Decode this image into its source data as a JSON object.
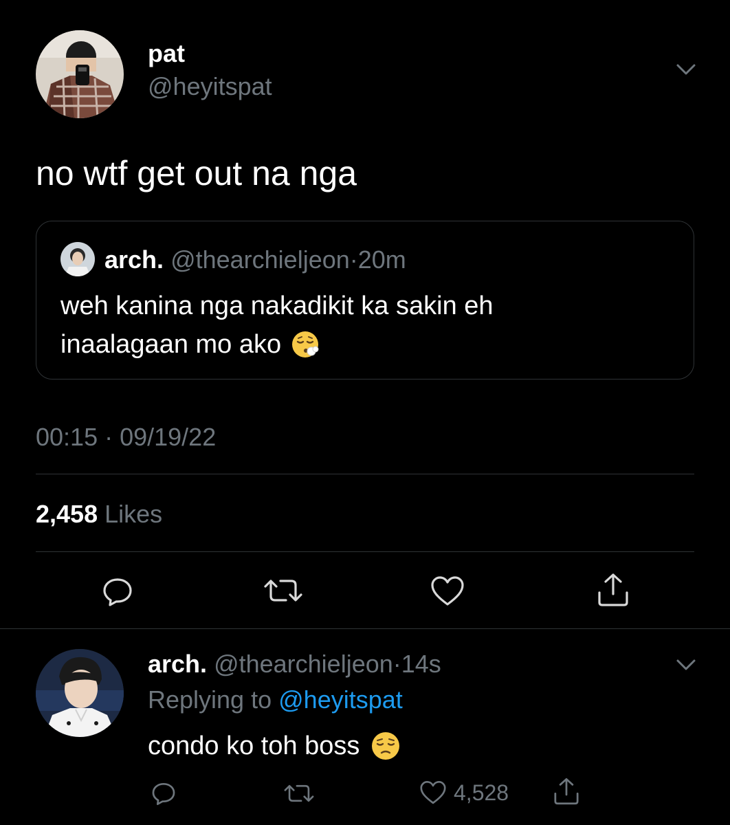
{
  "main_tweet": {
    "author_name": "pat",
    "author_handle": "@heyitspat",
    "text": "no wtf get out na nga",
    "quoted": {
      "author_name": "arch.",
      "author_handle": "@thearchieljeon",
      "separator": "·",
      "time": "20m",
      "line1": "weh kanina nga nakadikit ka sakin eh",
      "line2": "inaalagaan mo ako",
      "emoji": "face-exhaling-emoji"
    },
    "timestamp": "00:15 · 09/19/22",
    "likes_count": "2,458",
    "likes_label": "Likes",
    "actions": [
      "reply-icon",
      "retweet-icon",
      "like-icon",
      "share-icon"
    ]
  },
  "reply_tweet": {
    "author_name": "arch.",
    "author_handle": "@thearchieljeon",
    "separator": "·",
    "time": "14s",
    "replying_prefix": "Replying to",
    "replying_handle": "@heyitspat",
    "text": "condo ko toh boss",
    "emoji": "pensive-face-emoji",
    "like_count": "4,528"
  },
  "colors": {
    "background": "#000000",
    "text": "#ffffff",
    "muted": "#6e767d",
    "link": "#1d9bf0",
    "border": "#2f3336"
  }
}
